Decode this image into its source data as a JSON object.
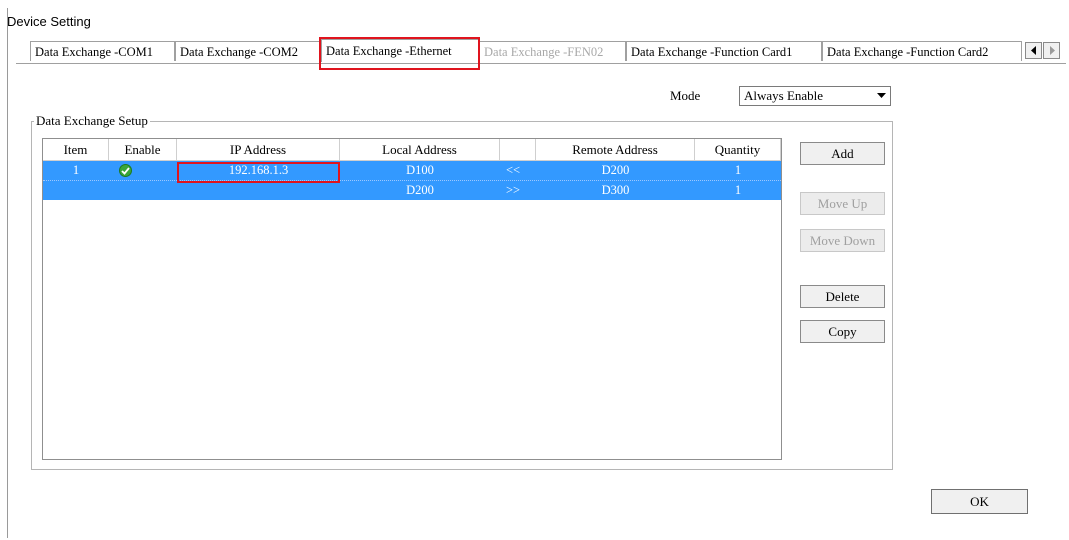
{
  "window": {
    "title": "Device Setting"
  },
  "tabs": [
    {
      "label": "Data Exchange -COM1",
      "state": "normal"
    },
    {
      "label": "Data Exchange -COM2",
      "state": "normal"
    },
    {
      "label": "Data Exchange -Ethernet",
      "state": "active"
    },
    {
      "label": "Data Exchange -FEN02",
      "state": "disabled"
    },
    {
      "label": "Data Exchange -Function Card1",
      "state": "normal"
    },
    {
      "label": "Data Exchange -Function Card2",
      "state": "normal"
    }
  ],
  "mode": {
    "label": "Mode",
    "value": "Always Enable"
  },
  "group": {
    "label": "Data Exchange Setup"
  },
  "table": {
    "columns": [
      "Item",
      "Enable",
      "IP Address",
      "Local Address",
      "",
      "Remote Address",
      "Quantity"
    ],
    "rows": [
      {
        "item": "1",
        "enabled": true,
        "ip": "192.168.1.3",
        "local": "D100",
        "direction": "<<",
        "remote": "D200",
        "quantity": "1"
      },
      {
        "item": "",
        "enabled": false,
        "ip": "",
        "local": "D200",
        "direction": ">>",
        "remote": "D300",
        "quantity": "1"
      }
    ]
  },
  "buttons": {
    "add": "Add",
    "move_up": "Move Up",
    "move_down": "Move Down",
    "delete": "Delete",
    "copy": "Copy",
    "ok": "OK"
  },
  "colors": {
    "selection": "#3399ff",
    "highlight_box": "#e0141e"
  },
  "icons": {
    "enable": "green-check-icon",
    "dropdown": "chevron-down-icon",
    "scroll_left": "triangle-left-icon",
    "scroll_right": "triangle-right-icon"
  }
}
